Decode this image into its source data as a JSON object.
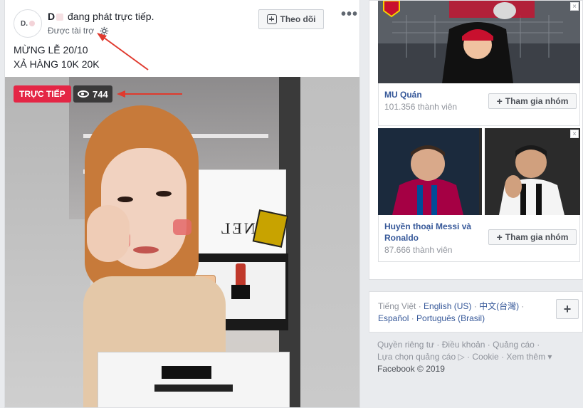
{
  "post": {
    "avatar_initial": "D.",
    "name_prefix": "D",
    "headline_rest": "đang phát trực tiếp.",
    "sponsored": "Được tài trợ",
    "follow_label": "Theo dõi",
    "more": "•••",
    "caption_line1": "MỪNG LỄ 20/10",
    "caption_line2": "XẢ HÀNG 10K 20K"
  },
  "video": {
    "live_label": "TRỰC TIẾP",
    "viewer_count": "744",
    "product_text": "ANEL"
  },
  "ads": [
    {
      "title": "MU Quán",
      "members": "101.356 thành viên",
      "join_label": "Tham gia nhóm",
      "close": "×"
    },
    {
      "title": "Huyền thoại Messi và Ronaldo",
      "members": "87.666 thành viên",
      "join_label": "Tham gia nhóm",
      "close": "×"
    }
  ],
  "languages": {
    "current": "Tiếng Việt",
    "options": [
      "English (US)",
      "中文(台灣)",
      "Español",
      "Português (Brasil)"
    ],
    "add_label": "+"
  },
  "footer": {
    "links": [
      "Quyền riêng tư",
      "Điều khoản",
      "Quảng cáo",
      "Lựa chọn quảng cáo",
      "Cookie",
      "Xem thêm"
    ],
    "copyright": "Facebook © 2019"
  },
  "colors": {
    "live_red": "#e42645",
    "link_blue": "#365899",
    "arrow_red": "#e03a2e"
  }
}
